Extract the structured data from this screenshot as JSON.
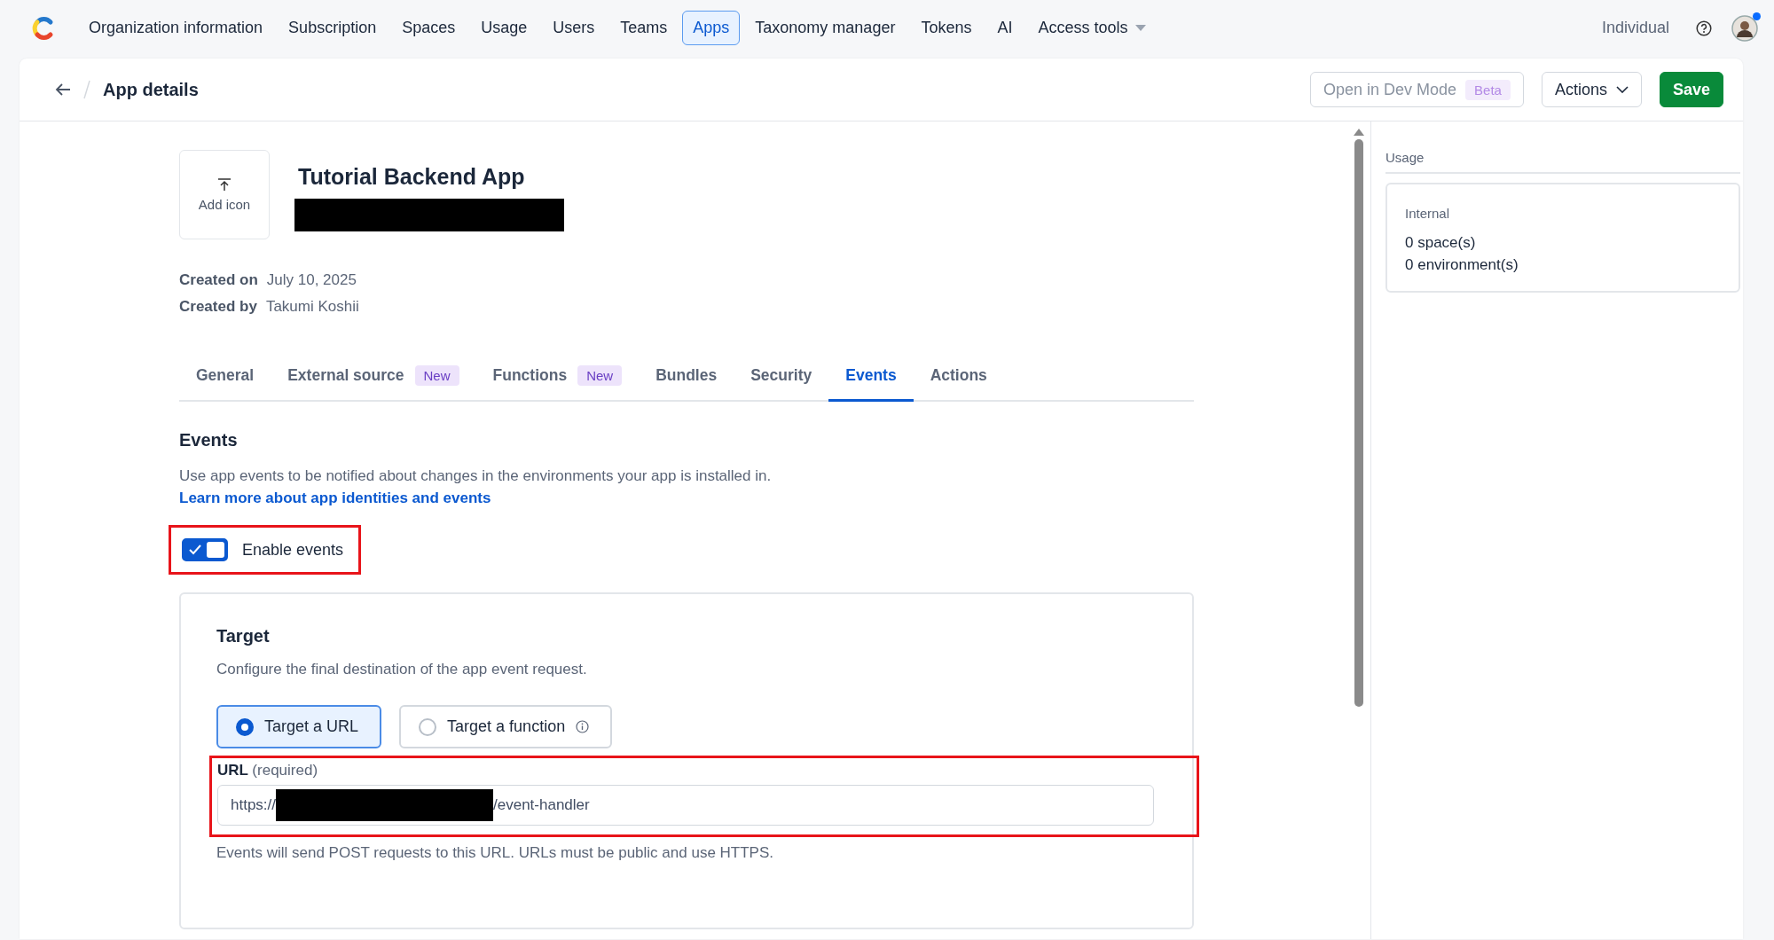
{
  "nav": {
    "items": [
      {
        "label": "Organization information",
        "selected": false
      },
      {
        "label": "Subscription",
        "selected": false
      },
      {
        "label": "Spaces",
        "selected": false
      },
      {
        "label": "Usage",
        "selected": false
      },
      {
        "label": "Users",
        "selected": false
      },
      {
        "label": "Teams",
        "selected": false
      },
      {
        "label": "Apps",
        "selected": true
      },
      {
        "label": "Taxonomy manager",
        "selected": false
      },
      {
        "label": "Tokens",
        "selected": false
      },
      {
        "label": "AI",
        "selected": false
      },
      {
        "label": "Access tools",
        "selected": false,
        "dropdown": true
      }
    ],
    "account": "Individual",
    "avatar": {
      "notification_dot": true
    }
  },
  "header": {
    "title": "App details",
    "dev_mode_button": {
      "label": "Open in Dev Mode",
      "badge": "Beta",
      "disabled": true
    },
    "actions_button": "Actions",
    "save_button": "Save"
  },
  "app": {
    "icon_label": "Add icon",
    "name": "Tutorial Backend App",
    "subtitle_redacted": true,
    "meta": [
      {
        "label": "Created on",
        "value": "July 10, 2025"
      },
      {
        "label": "Created by",
        "value": "Takumi Koshii"
      }
    ]
  },
  "tabs": [
    {
      "label": "General",
      "selected": false
    },
    {
      "label": "External source",
      "badge": "New",
      "selected": false
    },
    {
      "label": "Functions",
      "badge": "New",
      "selected": false
    },
    {
      "label": "Bundles",
      "selected": false
    },
    {
      "label": "Security",
      "selected": false
    },
    {
      "label": "Events",
      "selected": true
    },
    {
      "label": "Actions",
      "selected": false
    }
  ],
  "events": {
    "heading": "Events",
    "description": "Use app events to be notified about changes in the environments your app is installed in.",
    "link": "Learn more about app identities and events",
    "toggle": {
      "label": "Enable events",
      "on": true,
      "highlighted": true
    }
  },
  "target": {
    "heading": "Target",
    "description": "Configure the final destination of the app event request.",
    "options": [
      {
        "label": "Target a URL",
        "selected": true
      },
      {
        "label": "Target a function",
        "selected": false,
        "info": true
      }
    ],
    "url": {
      "label": "URL",
      "hint": "(required)",
      "value_start": "https://",
      "value_redacted": true,
      "value_end": "/event-handler",
      "highlighted": true,
      "help": "Events will send POST requests to this URL. URLs must be public and use HTTPS."
    }
  },
  "usage": {
    "heading": "Usage",
    "card": {
      "title": "Internal",
      "lines": [
        "0 space(s)",
        "0 environment(s)"
      ]
    }
  }
}
